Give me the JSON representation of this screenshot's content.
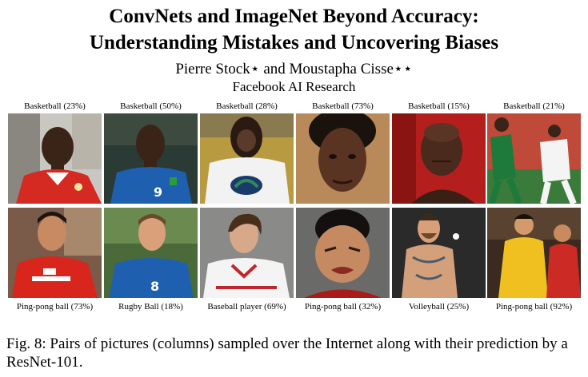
{
  "paper": {
    "title_line1": "ConvNets and ImageNet Beyond Accuracy:",
    "title_line2": "Understanding Mistakes and Uncovering Biases",
    "authors": "Pierre Stock⋆ and Moustapha Cisse⋆⋆",
    "affiliation": "Facebook AI Research"
  },
  "columns": [
    {
      "top_label": "Basketball (23%)",
      "bottom_label": "Ping-pong ball (73%)",
      "top_photo": "footballer-red-jersey",
      "bottom_photo": "footballer-red-evergrande-jersey"
    },
    {
      "top_label": "Basketball (50%)",
      "bottom_label": "Rugby Ball (18%)",
      "top_photo": "footballer-blue-italy-9",
      "bottom_photo": "footballer-blue-italy-8"
    },
    {
      "top_label": "Basketball (28%)",
      "bottom_label": "Baseball player (69%)",
      "top_photo": "fan-white-hockey-jersey",
      "bottom_photo": "hockey-player-white-jersey"
    },
    {
      "top_label": "Basketball (73%)",
      "bottom_label": "Ping-pong ball (32%)",
      "top_photo": "athlete-face-closeup",
      "bottom_photo": "weightlifter-face-closeup"
    },
    {
      "top_label": "Basketball (15%)",
      "bottom_label": "Volleyball (25%)",
      "top_photo": "boxer-red-background",
      "bottom_photo": "fighter-shirtless-tattoo"
    },
    {
      "top_label": "Basketball (21%)",
      "bottom_label": "Ping-pong ball (92%)",
      "top_photo": "footballers-green-white",
      "bottom_photo": "footballers-yellow-red"
    }
  ],
  "caption": "Fig. 8: Pairs of pictures (columns) sampled over the Internet along with their prediction by a ResNet-101."
}
